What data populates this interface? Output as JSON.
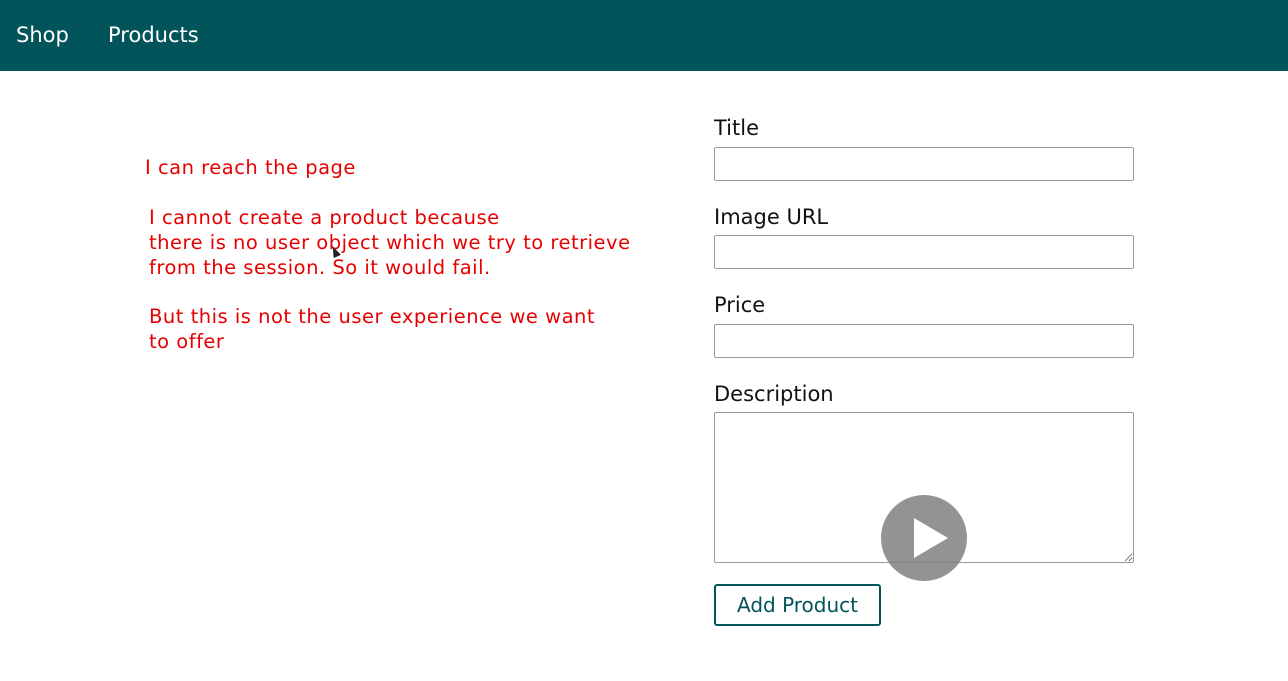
{
  "nav": {
    "items": [
      {
        "label": "Shop"
      },
      {
        "label": "Products"
      }
    ],
    "background_color": "#00545a"
  },
  "annotations": {
    "color": "#e60000",
    "note1": "I can reach the page",
    "note2": "I cannot create a product because\nthere is no user object which we try to retrieve\nfrom the session. So it would fail.",
    "note3": "But this is not the user experience we want\nto offer"
  },
  "form": {
    "title_label": "Title",
    "title_value": "",
    "image_label": "Image URL",
    "image_value": "",
    "price_label": "Price",
    "price_value": "",
    "description_label": "Description",
    "description_value": "",
    "submit_label": "Add Product"
  },
  "video_overlay": {
    "icon": "play-icon"
  }
}
